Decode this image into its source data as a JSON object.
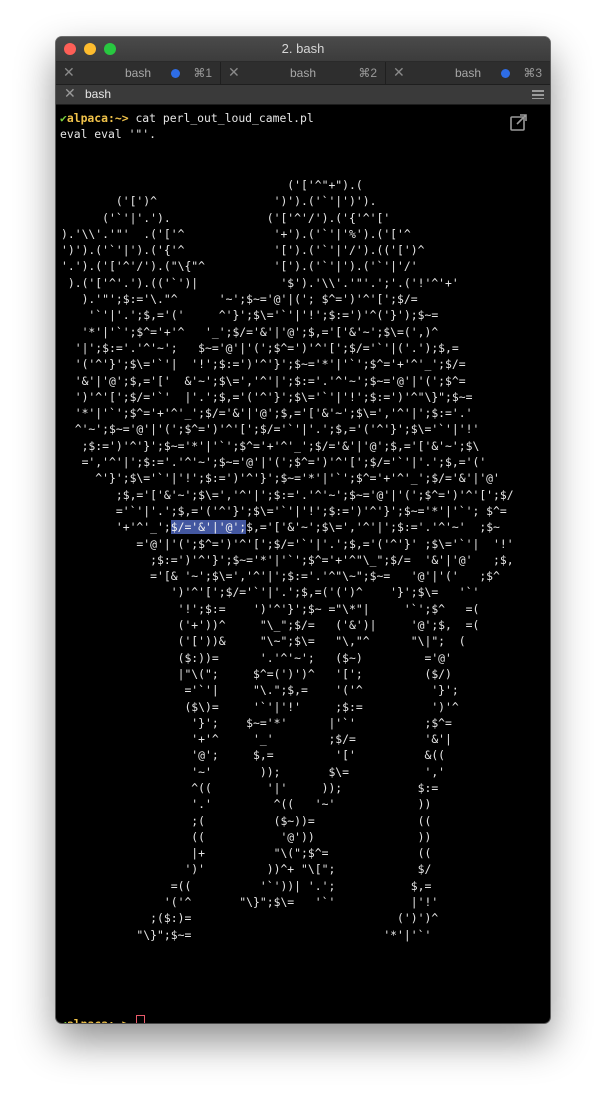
{
  "window": {
    "title": "2. bash"
  },
  "tabs": [
    {
      "label": "bash",
      "shortcut": "⌘1",
      "dot": true
    },
    {
      "label": "bash",
      "shortcut": "⌘2",
      "dot": false
    },
    {
      "label": "bash",
      "shortcut": "⌘3",
      "dot": true
    }
  ],
  "session": {
    "label": "bash"
  },
  "prompt": {
    "check": "✔",
    "host": "alpaca:~>",
    "command": "cat perl_out_loud_camel.pl"
  },
  "output_first_line": "eval eval '\"'.",
  "art_lines": [
    "                                 ('['^\"+\").(",
    "        ('[')^                 ')').('`'|')').",
    "      ('`'|'.').              ('['^'/').('{'^'['",
    ").'\\\\'.'\"'  .('['^             '+').('`'|'%').('['^",
    "')').('`'|').('{'^             '[').('`'|'/').(('[')^",
    "'.').('['^'/').(\"\\{\"^          '[').('`'|').('`'|'/'",
    " ).('['^'.').(('`')|            '$').'\\\\'.'\"'.';'.('!'^'+'",
    "   ).'\"';$:='\\.\"^      '~';$~='@'|('; $^=')'^'[';$/=",
    "    '`'|'.';$,='('     ^'}';$\\='`'|'!';$:=')'^('}');$~=",
    "   '*'|'`';$^='+'^   '_';$/='&'|'@';$,='['&'~';$\\=(',)^",
    "  '|';$:='.'^'~';   $~='@'|'(';$^=')'^'[';$/='`'|('.');$,=",
    "  '('^'}';$\\='`'|  '!';$:=')'^'}';$~='*'|'`';$^='+'^'_';$/=",
    "  '&'|'@';$,='['  &'~';$\\=','^'|';$:='.'^'~';$~='@'|'(';$^=",
    "  ')'^'[';$/='`'  |'.';$,='('^'}';$\\='`'|'!';$:=')'^\"\\}\";$~=",
    "  '*'|'`';$^='+'^'_';$/='&'|'@';$,='['&'~';$\\=','^'|';$:='.'",
    "  ^'~';$~='@'|'(';$^=')'^'[';$/='`'|'.';$,='('^'}';$\\='`'|'!'",
    "   ;$:=')'^'}';$~='*'|'`';$^='+'^'_';$/='&'|'@';$,='['&'~';$\\",
    "   =','^'|';$:='.'^'~';$~='@'|'(';$^=')'^'[';$/='`'|'.';$,='('",
    "     ^'}';$\\='`'|'!';$:=')'^'}';$~='*'|'`';$^='+'^'_';$/='&'|'@'",
    "        ;$,='['&'~';$\\=','^'|';$:='.'^'~';$~='@'|'(';$^=')'^'[';$/",
    "        ='`'|'.';$,='('^'}';$\\='`'|'!';$:=')'^'}';$~='*'|'`'; $^=",
    "          '+'^'_';",
    "           ='@'|'(';$^=')'^'[';$/='`'|'.';$,='('^'}' ;$\\='`'|  '!'",
    "             ;$:=')'^'}';$~='*'|'`';$^='+'^\"\\_\";$/=  '&'|'@'   ;$,",
    "             ='[& '~';$\\=','^'|';$:='.'^\"\\~\";$~=   '@'|'('   ;$^",
    "                ')'^'[';$/='`'|'.';$,=('(')^    '}';$\\=   '`'",
    "                 '!';$:=    ')'^'}';$~ =\"\\*\"|     '`';$^   =(",
    "                 ('+'))^     \"\\_\";$/=   ('&')|     '@';$,  =(",
    "                 ('['))&     \"\\~\";$\\=   \"\\,\"^      \"\\|\";  (",
    "                 ($:))=      '.'^'~';   ($~)         ='@'",
    "                 |\"\\(\";     $^=(')')^   '[';         ($/)",
    "                  ='`'|     \"\\.\";$,=    '('^          '}';",
    "                  ($\\)=     '`'|'!'     ;$:=          ')'^",
    "                   '}';    $~='*'      |'`'          ;$^=",
    "                   '+'^     '_'        ;$/=          '&'|",
    "                   '@';     $,=         '['          &((",
    "                   '~'       ));       $\\=           ','",
    "                   ^((        '|'     ));           $:=",
    "                   '.'         ^((   '~'            ))",
    "                   ;(          ($~))=               ((",
    "                   ((           '@'))               ))",
    "                   |+          \"\\(\";$^=             ((",
    "                  ')'         ))^+ \"\\[\";            $/",
    "                =((          '`'))| '.';           $,=",
    "               '('^       \"\\}\";$\\=   '`'           |'!'",
    "             ;($:)=                              (')')^",
    "           \"\\}\";$~=                            '*'|'`'"
  ],
  "highlight": {
    "before": "        '+'^'_';",
    "text": "$/='&'|'@';",
    "after": "$,='['&'~';$\\=','^'|';$:='.'^'~'  ;$~"
  }
}
